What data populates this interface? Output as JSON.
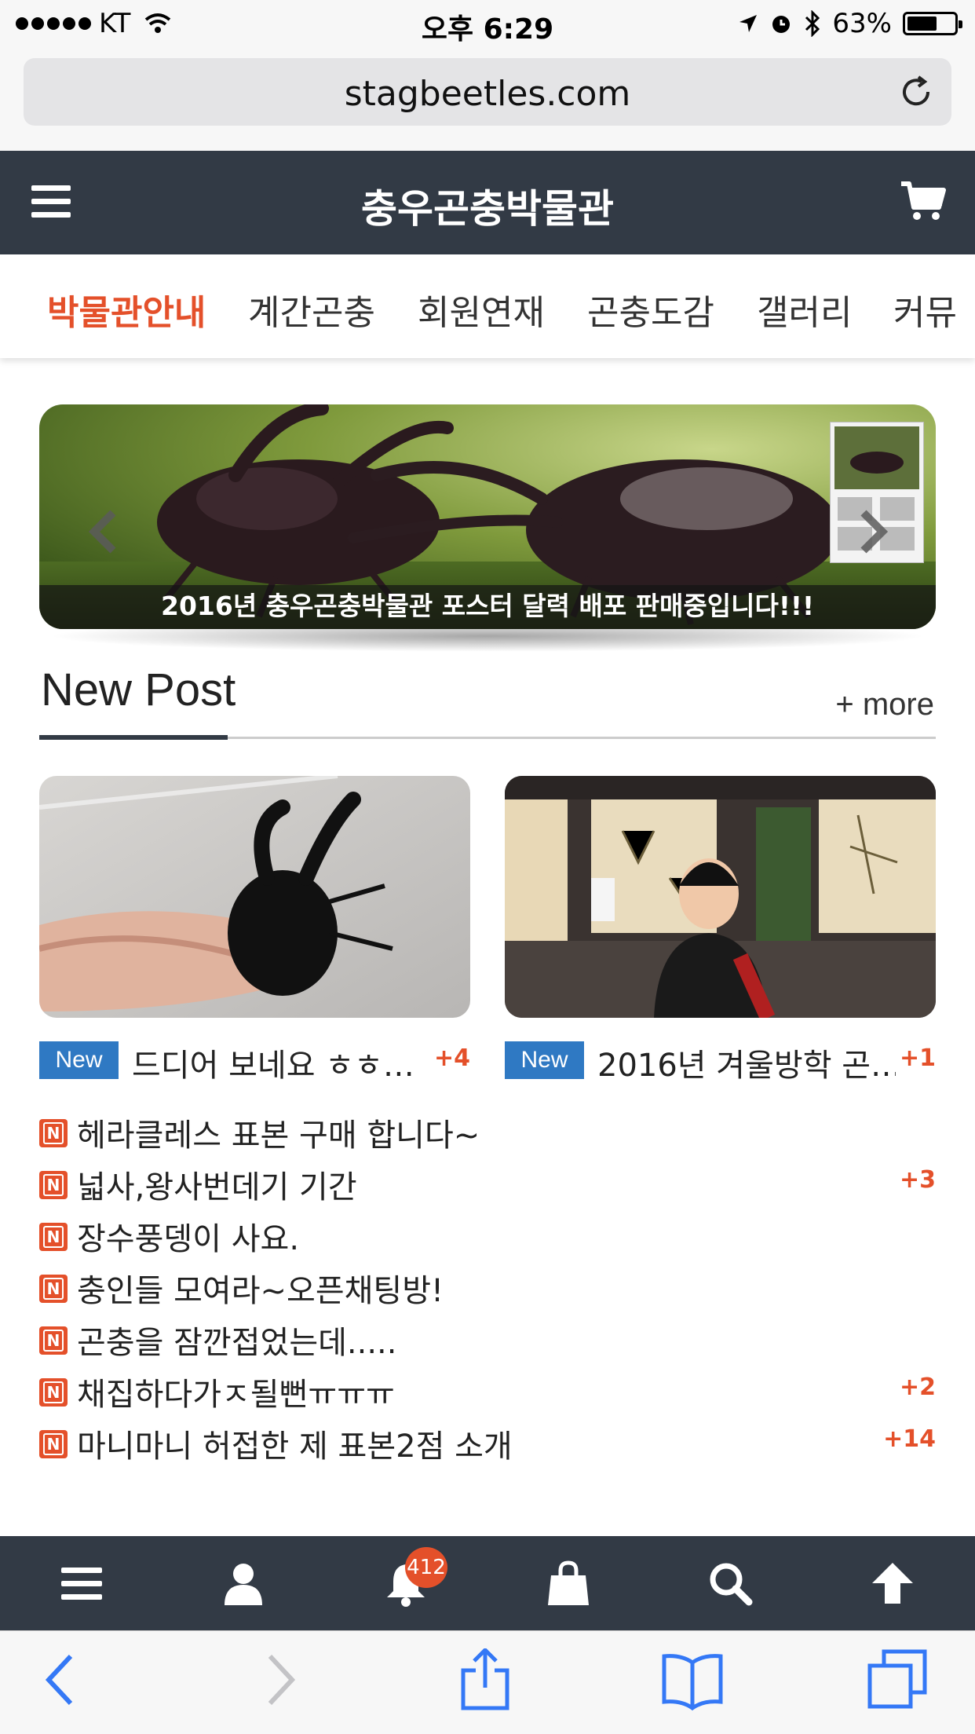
{
  "status_bar": {
    "carrier": "KT",
    "time": "오후 6:29",
    "battery_percent": "63%",
    "battery_level": 0.63
  },
  "browser": {
    "url": "stagbeetles.com"
  },
  "header": {
    "site_title": "충우곤충박물관"
  },
  "nav": {
    "items": [
      {
        "label": "박물관안내",
        "active": true
      },
      {
        "label": "계간곤충",
        "active": false
      },
      {
        "label": "회원연재",
        "active": false
      },
      {
        "label": "곤충도감",
        "active": false
      },
      {
        "label": "갤러리",
        "active": false
      },
      {
        "label": "커뮤",
        "active": false
      }
    ]
  },
  "banner": {
    "caption": "2016년 충우곤충박물관 포스터 달력 배포 판매중입니다!!!"
  },
  "new_post": {
    "title": "New Post",
    "more_label": "+ more",
    "cards": [
      {
        "badge": "New",
        "title": "드디어 보네요 ㅎㅎ…",
        "count": "+4"
      },
      {
        "badge": "New",
        "title": "2016년 겨울방학 곤…",
        "count": "+1"
      }
    ],
    "list": [
      {
        "icon": "N",
        "title": "헤라클레스 표본 구매 합니다~",
        "count": ""
      },
      {
        "icon": "N",
        "title": "넓사,왕사번데기 기간",
        "count": "+3"
      },
      {
        "icon": "N",
        "title": "장수풍뎅이 사요.",
        "count": ""
      },
      {
        "icon": "N",
        "title": "충인들 모여라~오픈채팅방!",
        "count": ""
      },
      {
        "icon": "N",
        "title": "곤충을 잠깐접었는데.....",
        "count": ""
      },
      {
        "icon": "N",
        "title": "채집하다가ㅈ될뻔ㅠㅠㅠ",
        "count": "+2"
      },
      {
        "icon": "N",
        "title": "마니마니 허접한 제 표본2점 소개",
        "count": "+14"
      }
    ]
  },
  "toolbar": {
    "notification_count": "412"
  },
  "colors": {
    "header_bg": "#323a45",
    "accent": "#e4502a",
    "badge_blue": "#2f79c3",
    "safari_blue": "#3478f6"
  }
}
